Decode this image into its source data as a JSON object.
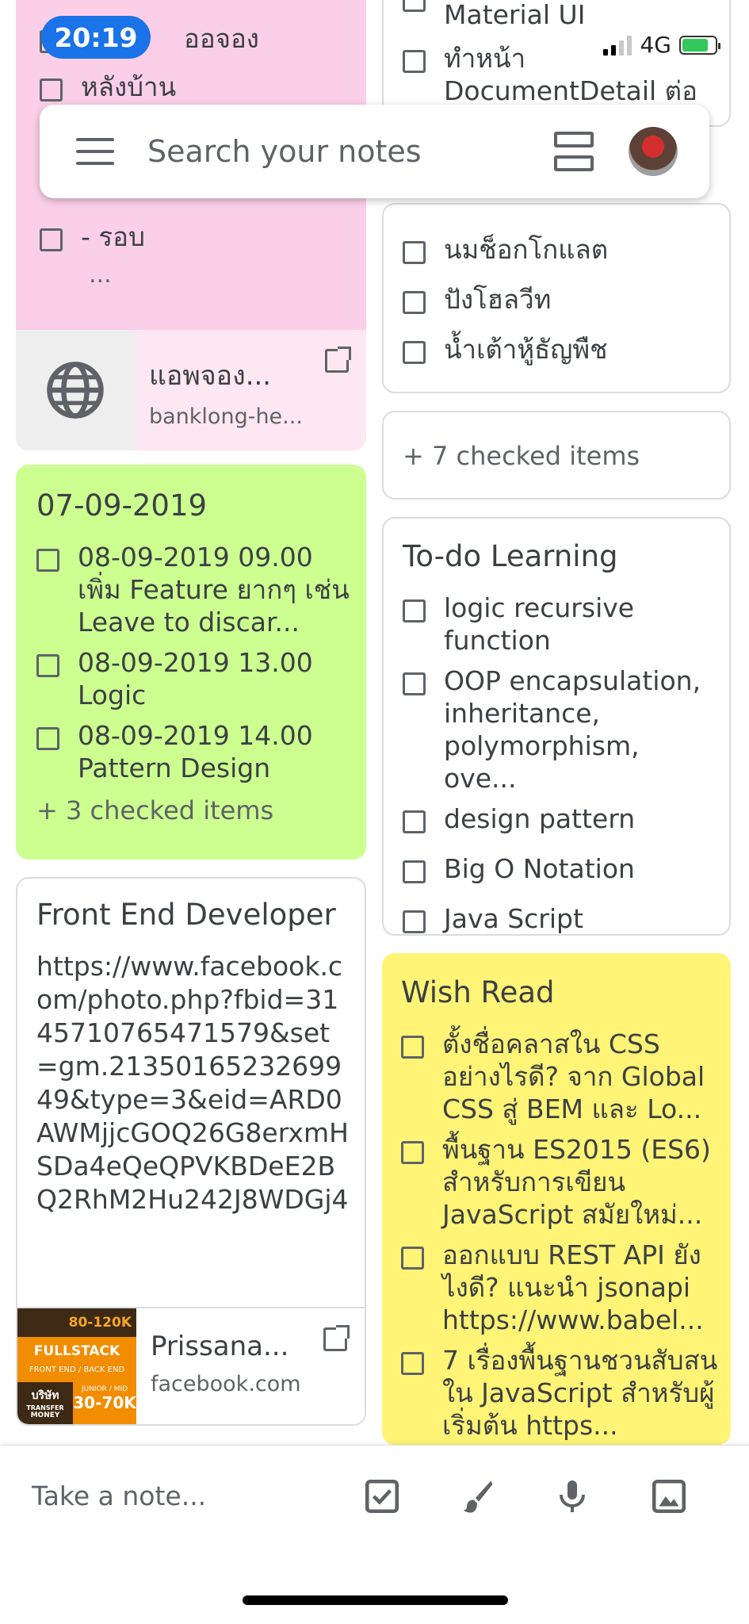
{
  "status_bar": {
    "time": "20:19",
    "network": "4G"
  },
  "search": {
    "placeholder": "Search your notes"
  },
  "notes": {
    "pink": {
      "items": [
        "ออจอง",
        "หลังบ้าน",
        "- รอบ"
      ],
      "ellipsis": "...",
      "link": {
        "title": "แอพจอง...",
        "domain": "banklong-he..."
      }
    },
    "green": {
      "title": "07-09-2019",
      "items": [
        "08-09-2019 09.00 เพิ่ม Feature ยากๆ เช่น Leave to discar...",
        "08-09-2019 13.00 Logic",
        "08-09-2019 14.00 Pattern Design"
      ],
      "checked": "+ 3 checked items"
    },
    "frontend": {
      "title": "Front End Developer",
      "text": "https://www.facebook.com/photo.php?fbid=3145710765471579&set=gm.2135016523269949&type=3&eid=ARD0AWMjjcGOQ26G8erxmHSDa4eQeQPVKBDeE2BQ2RhM2Hu242J8WDGj4D...",
      "link": {
        "title": "Prissana...",
        "domain": "facebook.com"
      },
      "thumb": {
        "top": "80-120K",
        "mid": "FULLSTACK",
        "mid2": "FRONT END / BACK END",
        "company": "บริษัท",
        "transfer": "TRANSFER",
        "money": "MONEY",
        "junior": "JUNIOR / MID",
        "salary": "30-70K"
      }
    },
    "material": {
      "items": [
        "Material UI",
        "ทำหน้า DocumentDetail ต่อ"
      ]
    },
    "shopping": {
      "items": [
        "นมช็อกโกแลต",
        "ปังโฮลวีท",
        "น้ำเต้าหู้ธัญพืช"
      ]
    },
    "checked_only": {
      "text": "+ 7 checked items"
    },
    "todo": {
      "title": "To-do Learning",
      "items": [
        "logic recursive function",
        "OOP encapsulation, inheritance, polymorphism, ove...",
        "design pattern",
        "Big O Notation",
        "Java Script"
      ]
    },
    "wish": {
      "title": "Wish Read",
      "items": [
        "ตั้งชื่อคลาสใน CSS อย่างไรดี? จาก Global CSS สู่ BEM และ Lo...",
        "พื้นฐาน ES2015 (ES6) สำหรับการเขียน JavaScript สมัยใหม่...",
        "ออกแบบ REST API ยังไงดี? แนะนำ jsonapi https://www.babel...",
        "7 เรื่องพื้นฐานชวนสับสนใน JavaScript สำหรับผู้เริ่มต้น https..."
      ]
    }
  },
  "bottom_bar": {
    "placeholder": "Take a note..."
  },
  "colors": {
    "pink": "#fbcfe8",
    "green": "#ccff90",
    "yellow": "#fff475",
    "accent": "#1a73e8"
  },
  "icons": [
    "menu-icon",
    "list-view-icon",
    "globe-icon",
    "open-link-icon",
    "checkbox-icon",
    "brush-icon",
    "mic-icon",
    "image-icon"
  ]
}
